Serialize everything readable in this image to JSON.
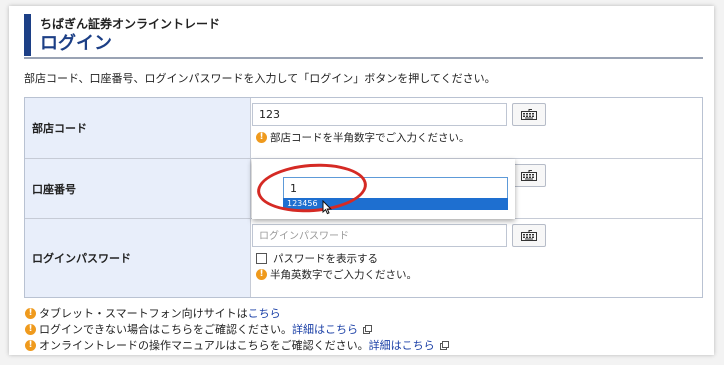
{
  "header": {
    "subtitle": "ちばぎん証券オンライントレード",
    "title": "ログイン"
  },
  "instruction": "部店コード、口座番号、ログインパスワードを入力して「ログイン」ボタンを押してください。",
  "form": {
    "branch": {
      "label": "部店コード",
      "value": "123",
      "hint": "部店コードを半角数字でご入力ください。"
    },
    "account": {
      "label": "口座番号",
      "value": "1",
      "autocomplete_option": "123456"
    },
    "password": {
      "label": "ログインパスワード",
      "placeholder": "ログインパスワード",
      "show_password_label": "パスワードを表示する",
      "hint": "半角英数字でご入力ください。"
    }
  },
  "links": [
    {
      "text": "タブレット・スマートフォン向けサイトは",
      "link": "こちら"
    },
    {
      "text": "ログインできない場合はこちらをご確認ください。",
      "link": "詳細はこちら"
    },
    {
      "text": "オンライントレードの操作マニュアルはこちらをご確認ください。",
      "link": "詳細はこちら"
    }
  ],
  "icons": {
    "warning": "!",
    "keyboard": "keyboard-icon",
    "external": "external-link-icon"
  },
  "colors": {
    "brand": "#1c3f86",
    "label_bg": "#e8eefa",
    "warning": "#ef9a1d",
    "link": "#1a3fa6",
    "highlight_circle": "#d52a24",
    "selected_option": "#1e6fd0"
  }
}
